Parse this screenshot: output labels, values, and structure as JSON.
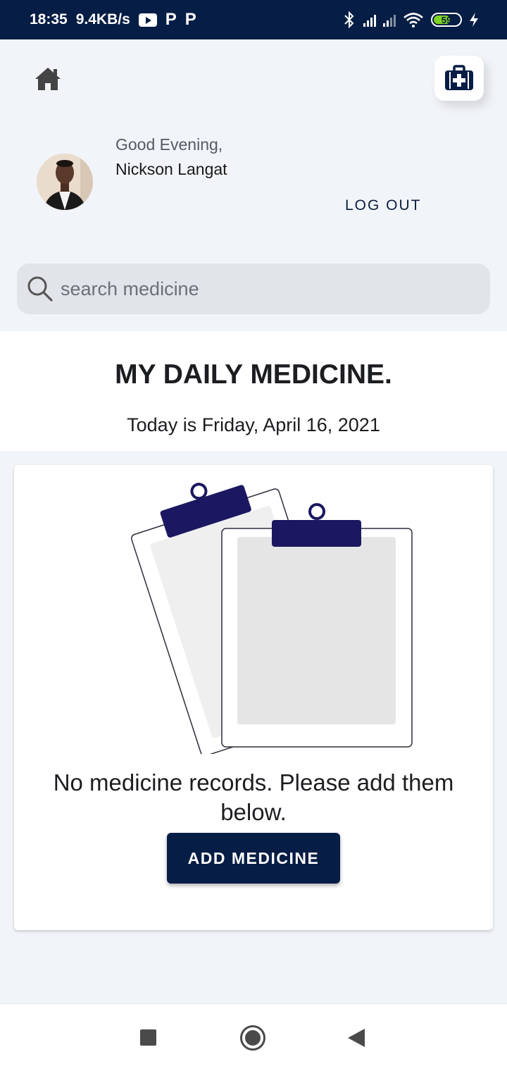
{
  "status_bar": {
    "time": "18:35",
    "speed": "9.4KB/s",
    "notif_p1": "P",
    "notif_p2": "P",
    "battery": "59"
  },
  "header": {
    "home_icon": "home-icon",
    "kit_icon": "first-aid-kit-icon"
  },
  "profile": {
    "greeting": "Good Evening,",
    "name": "Nickson Langat",
    "logout_label": "LOG OUT"
  },
  "search": {
    "placeholder": "search medicine",
    "value": ""
  },
  "main": {
    "title": "MY DAILY MEDICINE.",
    "date": "Today is Friday, April 16, 2021"
  },
  "empty_state": {
    "message": "No medicine records. Please add them below.",
    "button_label": "ADD MEDICINE"
  },
  "colors": {
    "primary": "#061d45",
    "background": "#f1f4f8",
    "clip_accent": "#1b1760"
  }
}
